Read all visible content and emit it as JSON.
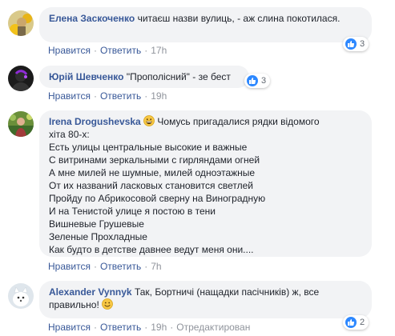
{
  "comments": [
    {
      "author": "Елена Заскоченко",
      "text": "читаєш назви вулиць, - аж слина покотилася.",
      "actions": {
        "like": "Нравится",
        "reply": "Ответить",
        "time": "17h"
      },
      "reactions_count": "3"
    },
    {
      "author": "Юрій Шевченко",
      "text": "\"Прополісний\" - зе бест",
      "actions": {
        "like": "Нравится",
        "reply": "Ответить",
        "time": "19h"
      },
      "reactions_count": "3"
    },
    {
      "author": "Irena Drogushevska",
      "lines": [
        "Чомусь пригадалися рядки відомого",
        "хіта 80-х:",
        "Есть улицы центральные высокие и важные",
        "С витринами зеркальными с гирляндами огней",
        "А мне милей не шумные, милей одноэтажные",
        "От их названий ласковых становится светлей",
        "Пройду по Абрикосовой сверну на Виноградную",
        "И на Тенистой улице я постою в тени",
        "Вишневые Грушевые",
        "Зеленые Прохладные",
        "Как будто в детстве давнее ведут меня они...."
      ],
      "actions": {
        "like": "Нравится",
        "reply": "Ответить",
        "time": "7h"
      }
    },
    {
      "author": "Alexander Vynnyk",
      "text_line1": "Так, Бортничі (нащадки пасічників) ж, все",
      "text_line2": "правильно!",
      "actions": {
        "like": "Нравится",
        "reply": "Ответить",
        "time": "19h",
        "edited": "Отредактирован"
      },
      "reactions_count": "2"
    }
  ],
  "colors": {
    "author": "#385898",
    "bubble": "#f2f3f5",
    "like_badge": "#2d88ff",
    "meta": "#90949c"
  }
}
